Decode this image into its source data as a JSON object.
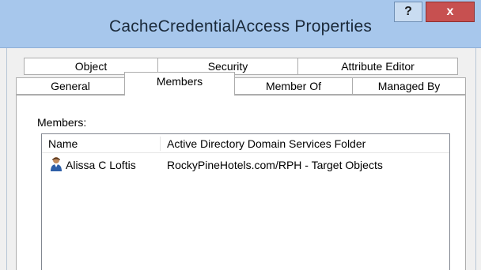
{
  "window": {
    "title": "CacheCredentialAccess Properties",
    "help_label": "?",
    "close_label": "x"
  },
  "tabs_row1": [
    "Object",
    "Security",
    "Attribute Editor"
  ],
  "tabs_row2": [
    "General",
    "Members",
    "Member Of",
    "Managed By"
  ],
  "active_tab": "Members",
  "members": {
    "label": "Members:",
    "columns": [
      "Name",
      "Active Directory Domain Services Folder"
    ],
    "rows": [
      {
        "icon": "user-icon",
        "name": "Alissa C Loftis",
        "folder": "RockyPineHotels.com/RPH - Target Objects"
      }
    ]
  }
}
